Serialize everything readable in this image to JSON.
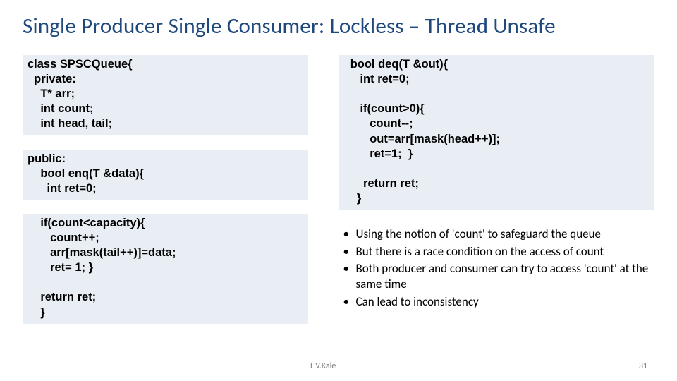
{
  "title": "Single Producer Single Consumer: Lockless – Thread Unsafe",
  "code": {
    "left_top": "class SPSCQueue{\n  private:\n    T* arr;\n    int count;\n    int head, tail;",
    "left_mid": "public:\n    bool enq(T &data){\n      int ret=0;",
    "left_bot": "    if(count<capacity){\n       count++;\n       arr[mask(tail++)]=data;\n       ret= 1; }\n\n    return ret;\n    }",
    "right_top": "  bool deq(T &out){\n     int ret=0;\n\n     if(count>0){\n        count--;\n        out=arr[mask(head++)];\n        ret=1;  }\n\n      return ret;\n    }"
  },
  "bullets": [
    "Using the notion of 'count' to safeguard the queue",
    "But there is a race condition on the access of count",
    "Both producer and consumer can try to access 'count' at the same time",
    "Can lead to inconsistency"
  ],
  "footer": {
    "author": "L.V.Kale",
    "page": "31"
  }
}
